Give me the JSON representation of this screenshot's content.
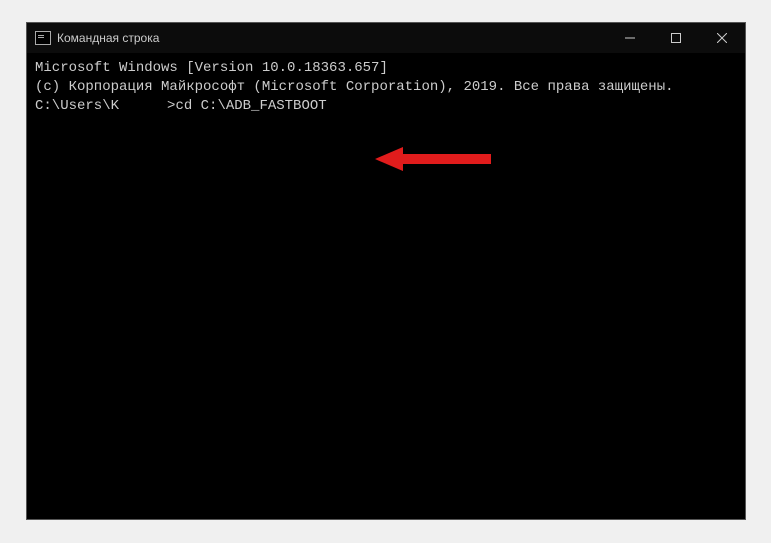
{
  "window": {
    "title": "Командная строка"
  },
  "terminal": {
    "line1": "Microsoft Windows [Version 10.0.18363.657]",
    "line2": "(c) Корпорация Майкрософт (Microsoft Corporation), 2019. Все права защищены.",
    "blank": "",
    "prompt_prefix": "C:\\Users\\",
    "prompt_user_first": "K",
    "prompt_suffix": ">",
    "command": "cd C:\\ADB_FASTBOOT"
  },
  "colors": {
    "arrow": "#e11a1a"
  }
}
